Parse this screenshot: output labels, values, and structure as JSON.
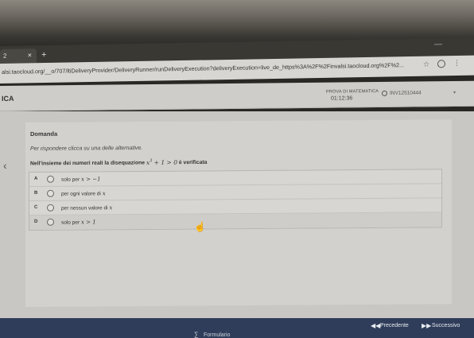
{
  "browser": {
    "tab": {
      "title": "2",
      "close_glyph": "×"
    },
    "new_tab_glyph": "+",
    "minimize_glyph": "—",
    "url": "alsi.taocloud.org/__o/707/ltiDeliveryProvider/DeliveryRunner/runDeliveryExecution?deliveryExecution=live_de_https%3A%2F%2Finvalsi.taocloud.org%2F%2...",
    "icons": {
      "star": "star-icon",
      "profile": "profile-icon",
      "menu": "menu-icon"
    }
  },
  "header": {
    "app_title": "ICA",
    "test_name": "PROVA DI MATEMATICA",
    "timer": "01:12:36",
    "user_code": "INV12510444"
  },
  "question": {
    "heading": "Domanda",
    "instruction": "Per rispondere clicca su una delle alternative.",
    "prefix": "Nell'insieme dei numeri reali la disequazione",
    "math": "x",
    "exponent": "3",
    "math_rest": "+ 1 > 0",
    "suffix": "è verificata",
    "options": [
      {
        "letter": "A",
        "text": "solo per",
        "math": "x > −1"
      },
      {
        "letter": "B",
        "text": "per ogni valore di",
        "math": "x"
      },
      {
        "letter": "C",
        "text": "per nessun valore di",
        "math": "x"
      },
      {
        "letter": "D",
        "text": "solo per",
        "math": "x > 1"
      }
    ]
  },
  "footer": {
    "formulario": "Formulario",
    "previous": "Precedente",
    "next": "Successivo"
  },
  "colors": {
    "footer_bg": "#2f3d5a",
    "content_bg": "#c9c7c3"
  }
}
